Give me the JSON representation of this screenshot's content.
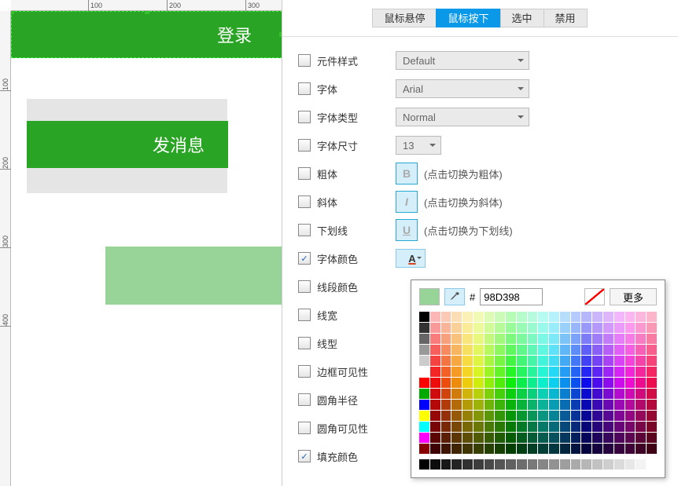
{
  "ruler": {
    "h": [
      "100",
      "200",
      "300"
    ],
    "v": [
      "100",
      "200",
      "300",
      "400"
    ]
  },
  "canvas": {
    "login_label": "登录",
    "send_label": "发消息"
  },
  "tabs": {
    "hover": "鼠标悬停",
    "down": "鼠标按下",
    "selected": "选中",
    "disabled": "禁用"
  },
  "props": {
    "widget_style": {
      "label": "元件样式",
      "value": "Default"
    },
    "font": {
      "label": "字体",
      "value": "Arial"
    },
    "font_type": {
      "label": "字体类型",
      "value": "Normal"
    },
    "font_size": {
      "label": "字体尺寸",
      "value": "13"
    },
    "bold": {
      "label": "粗体",
      "hint": "(点击切换为粗体)",
      "btn": "B"
    },
    "italic": {
      "label": "斜体",
      "hint": "(点击切换为斜体)",
      "btn": "I"
    },
    "underline": {
      "label": "下划线",
      "hint": "(点击切换为下划线)",
      "btn": "U"
    },
    "font_color": {
      "label": "字体颜色"
    },
    "line_color": {
      "label": "线段颜色"
    },
    "line_width": {
      "label": "线宽"
    },
    "line_style": {
      "label": "线型"
    },
    "border_vis": {
      "label": "边框可见性"
    },
    "corner_radius": {
      "label": "圆角半径"
    },
    "corner_vis": {
      "label": "圆角可见性"
    },
    "fill_color": {
      "label": "填充颜色"
    }
  },
  "color_picker": {
    "swatch": "#98d398",
    "hex": "98D398",
    "hash": "#",
    "more": "更多"
  },
  "checked": {
    "font_color": "✓",
    "fill_color": "✓"
  }
}
